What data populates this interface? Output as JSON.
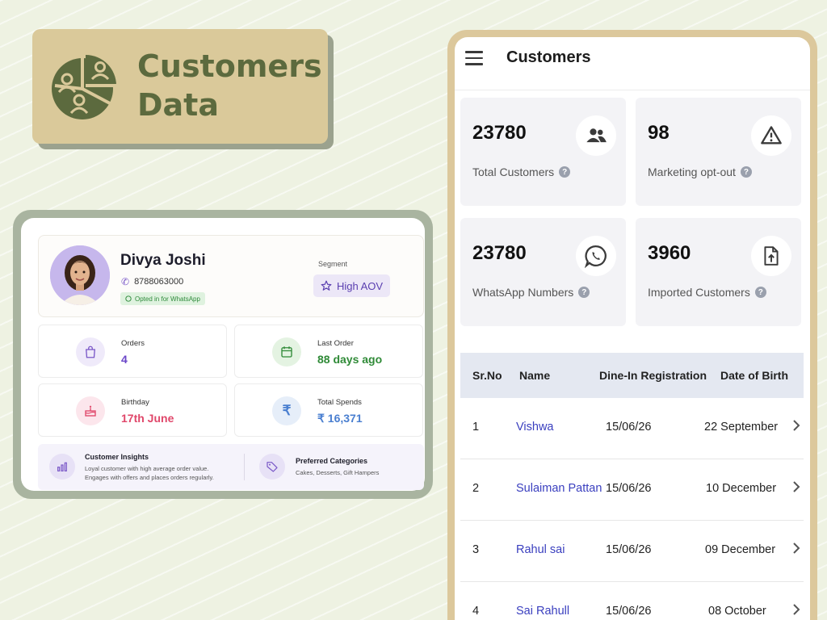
{
  "badge": {
    "line1": "Customers",
    "line2": "Data"
  },
  "profile": {
    "name": "Divya Joshi",
    "phone": "8788063000",
    "whatsapp_badge": "Opted in for WhatsApp",
    "segment_label": "Segment",
    "segment_value": "High AOV",
    "stats": [
      {
        "label": "Orders",
        "value": "4",
        "color": "#6a45c8"
      },
      {
        "label": "Last Order",
        "value": "88 days ago",
        "color": "#2f8a37"
      },
      {
        "label": "Birthday",
        "value": "17th June",
        "color": "#e0476a"
      },
      {
        "label": "Total Spends",
        "value": "₹ 16,371",
        "color": "#4a7fd0"
      }
    ],
    "insights": {
      "title": "Customer Insights",
      "line1": "Loyal customer with high average order value.",
      "line2": "Engages with offers and places orders regularly."
    },
    "preferred": {
      "title": "Preferred Categories",
      "value": "Cakes, Desserts, Gift Hampers"
    }
  },
  "app": {
    "title": "Customers",
    "metrics": [
      {
        "value": "23780",
        "label": "Total Customers",
        "icon": "users-icon"
      },
      {
        "value": "98",
        "label": "Marketing opt-out",
        "icon": "warning-icon"
      },
      {
        "value": "23780",
        "label": "WhatsApp Numbers",
        "icon": "whatsapp-icon"
      },
      {
        "value": "3960",
        "label": "Imported Customers",
        "icon": "file-upload-icon"
      }
    ],
    "table": {
      "headers": [
        "Sr.No",
        "Name",
        "Dine-In Registration",
        "Date of Birth"
      ],
      "rows": [
        {
          "sr": "1",
          "name": "Vishwa",
          "reg": "15/06/26",
          "dob": "22 September"
        },
        {
          "sr": "2",
          "name": "Sulaiman Pattan",
          "reg": "15/06/26",
          "dob": "10 December"
        },
        {
          "sr": "3",
          "name": "Rahul sai",
          "reg": "15/06/26",
          "dob": "09 December"
        },
        {
          "sr": "4",
          "name": "Sai Rahull",
          "reg": "15/06/26",
          "dob": "08 October"
        }
      ]
    }
  },
  "colors": {
    "accent": "#5c6a3e",
    "badge_bg": "#dac99a",
    "link": "#3a3fbf"
  }
}
